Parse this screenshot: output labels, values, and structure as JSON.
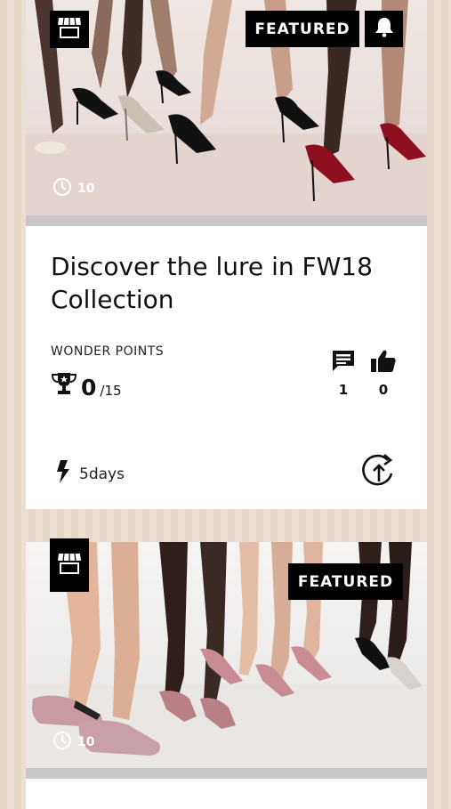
{
  "posts": [
    {
      "badge": "FEATURED",
      "timer": "10",
      "title": "Discover the lure in FW18 Collection",
      "points_label": "WONDER POINTS",
      "points_current": "0",
      "points_total": "/15",
      "comments": "1",
      "likes": "0",
      "duration": "5days",
      "icons": [
        "store-icon",
        "bell-icon",
        "clock-icon",
        "trophy-icon",
        "comment-icon",
        "thumbs-up-icon",
        "flash-icon",
        "share-icon"
      ]
    },
    {
      "badge": "FEATURED",
      "timer": "10",
      "icons": [
        "store-icon",
        "clock-icon"
      ]
    }
  ],
  "colors": {
    "badge_bg": "#000000",
    "page_bg": "#e6d8c9",
    "card_bg": "#ffffff",
    "divider": "#c9c8c8"
  }
}
